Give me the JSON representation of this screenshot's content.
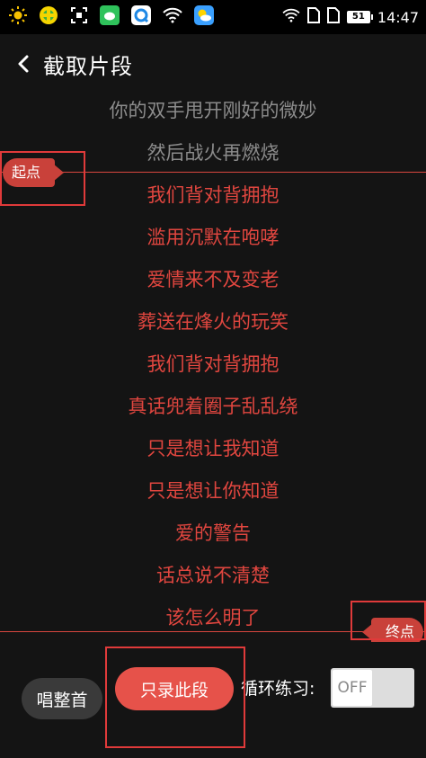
{
  "status_bar": {
    "time": "14:47",
    "battery": "51",
    "left_icons": [
      "sun-icon",
      "cloud-game-icon",
      "scan-icon",
      "wechat-icon",
      "q-app-icon",
      "wifi-icon",
      "weather-icon"
    ],
    "right_icons": [
      "wifi-icon",
      "sim-icon",
      "sim-icon",
      "battery-icon"
    ]
  },
  "header": {
    "title": "截取片段",
    "back_icon": "chevron-left-icon"
  },
  "lyrics": [
    {
      "text": "你的双手甩开刚好的微妙",
      "selected": false
    },
    {
      "text": "然后战火再燃烧",
      "selected": false
    },
    {
      "text": "我们背对背拥抱",
      "selected": true
    },
    {
      "text": "滥用沉默在咆哮",
      "selected": true
    },
    {
      "text": "爱情来不及变老",
      "selected": true
    },
    {
      "text": "葬送在烽火的玩笑",
      "selected": true
    },
    {
      "text": "我们背对背拥抱",
      "selected": true
    },
    {
      "text": "真话兜着圈子乱乱绕",
      "selected": true
    },
    {
      "text": "只是想让我知道",
      "selected": true
    },
    {
      "text": "只是想让你知道",
      "selected": true
    },
    {
      "text": "爱的警告",
      "selected": true
    },
    {
      "text": "话总说不清楚",
      "selected": true
    },
    {
      "text": "该怎么明了",
      "selected": true
    }
  ],
  "markers": {
    "start_label": "起点",
    "end_label": "终点"
  },
  "controls": {
    "whole_song_label": "唱整首",
    "segment_label": "只录此段",
    "loop_label": "循环练习:",
    "toggle_label": "OFF"
  },
  "colors": {
    "accent": "#e6524a",
    "selected_lyric": "#e0463f",
    "unselected_lyric": "#8c8c8c"
  }
}
